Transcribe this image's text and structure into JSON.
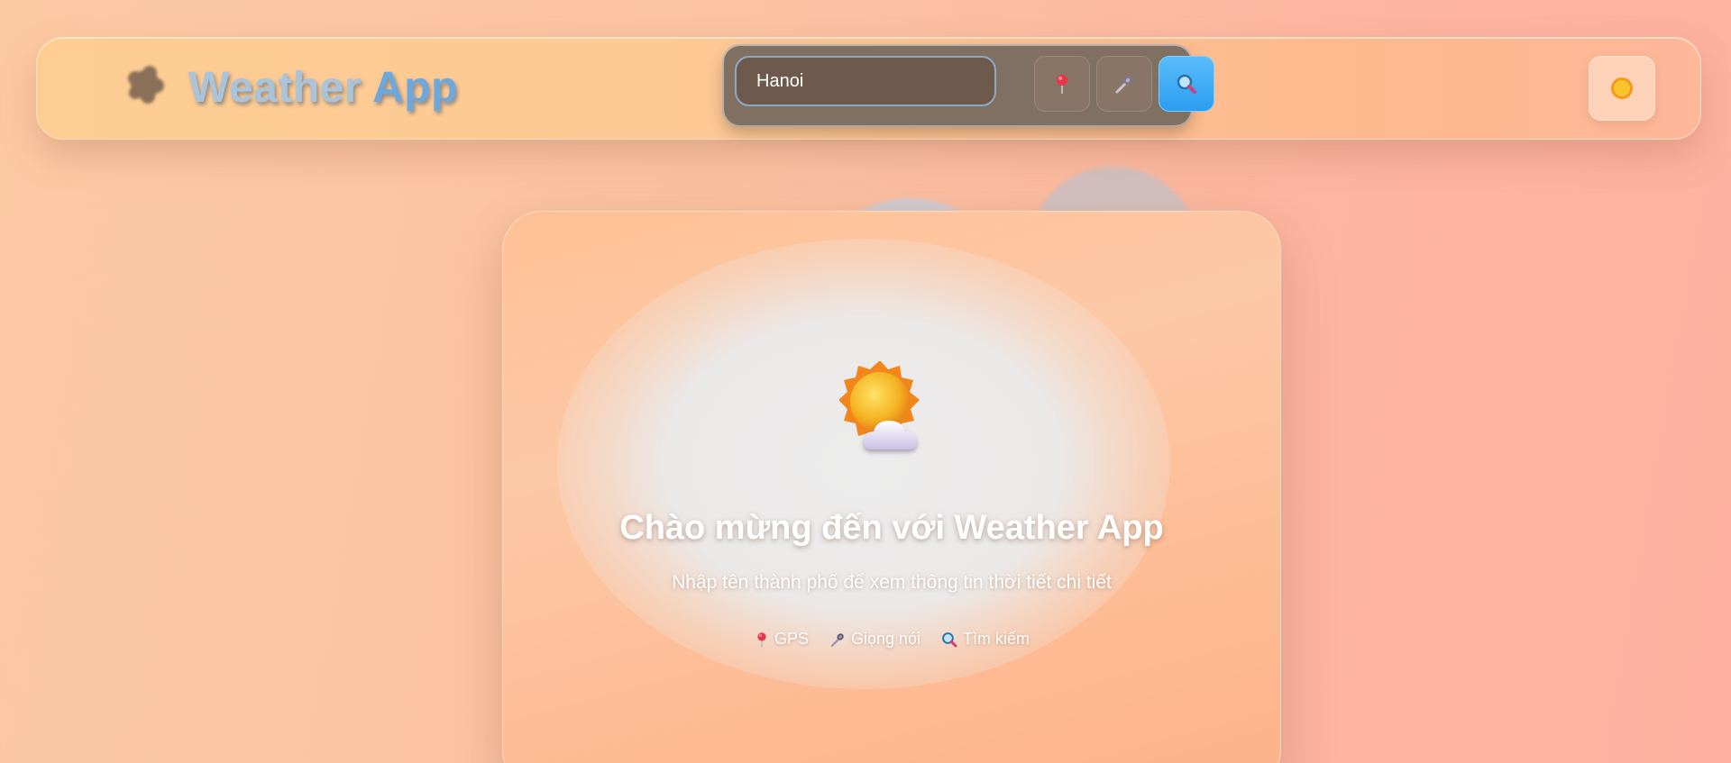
{
  "header": {
    "title_part1": "Weather",
    "title_part2": "App",
    "search": {
      "value": "Hanoi",
      "placeholder": ""
    },
    "buttons": {
      "gps_icon": "pushpin-icon",
      "voice_icon": "microphone-icon",
      "search_icon": "search-icon",
      "theme_icon": "sun-icon"
    }
  },
  "welcome": {
    "icon": "sun-behind-cloud-icon",
    "title": "Chào mừng đến với Weather App",
    "subtitle": "Nhập tên thành phố để xem thông tin thời tiết chi tiết",
    "features": [
      {
        "icon": "pushpin-icon",
        "label": "GPS"
      },
      {
        "icon": "microphone-icon",
        "label": "Giọng nói"
      },
      {
        "icon": "search-icon",
        "label": "Tìm kiếm"
      }
    ]
  },
  "colors": {
    "accent_blue": "#2b9df0",
    "title_blue": "#6da8dc",
    "header_bg": "#fdcd92",
    "card_bg": "#fdc8a6"
  }
}
